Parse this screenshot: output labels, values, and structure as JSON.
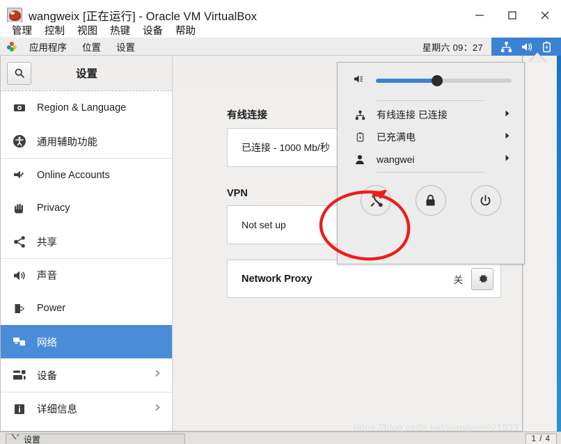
{
  "vbox": {
    "title": "wangweix [正在运行] - Oracle VM VirtualBox",
    "icon": "virtualbox-icon",
    "window_buttons": [
      {
        "name": "minimize-button",
        "glyph": "minimize-icon"
      },
      {
        "name": "maximize-button",
        "glyph": "maximize-icon"
      },
      {
        "name": "close-button",
        "glyph": "close-icon"
      }
    ],
    "menu": [
      {
        "label": "管理"
      },
      {
        "label": "控制"
      },
      {
        "label": "视图"
      },
      {
        "label": "热键"
      },
      {
        "label": "设备"
      },
      {
        "label": "帮助"
      }
    ]
  },
  "gnome_panel": {
    "app_icon": "applications-icon",
    "menus": [
      {
        "label": "应用程序"
      },
      {
        "label": "位置"
      },
      {
        "label": "设置"
      }
    ],
    "clock": "星期六 09：27",
    "status_icons": [
      {
        "name": "network-wired-icon"
      },
      {
        "name": "volume-icon"
      },
      {
        "name": "battery-charged-icon"
      }
    ],
    "status_bg": "#3b82d4"
  },
  "settings": {
    "header": {
      "search_icon": "search-icon",
      "title": "设置"
    },
    "sidebar": {
      "items": [
        {
          "label": "Region & Language",
          "icon": "region-language-icon",
          "selected": false,
          "chevron": false,
          "separator": false
        },
        {
          "label": "通用辅助功能",
          "icon": "accessibility-icon",
          "selected": false,
          "chevron": false,
          "separator": false
        },
        {
          "label": "Online Accounts",
          "icon": "online-accounts-icon",
          "selected": false,
          "chevron": false,
          "separator": true
        },
        {
          "label": "Privacy",
          "icon": "privacy-hand-icon",
          "selected": false,
          "chevron": false,
          "separator": false
        },
        {
          "label": "共享",
          "icon": "sharing-icon",
          "selected": false,
          "chevron": false,
          "separator": false
        },
        {
          "label": "声音",
          "icon": "sound-icon",
          "selected": false,
          "chevron": false,
          "separator": true
        },
        {
          "label": "Power",
          "icon": "power-plug-icon",
          "selected": false,
          "chevron": false,
          "separator": false
        },
        {
          "label": "网络",
          "icon": "network-icon",
          "selected": true,
          "chevron": false,
          "separator": false
        },
        {
          "label": "设备",
          "icon": "devices-icon",
          "selected": false,
          "chevron": true,
          "separator": false
        },
        {
          "label": "详细信息",
          "icon": "details-info-icon",
          "selected": false,
          "chevron": true,
          "separator": true
        }
      ]
    },
    "content": {
      "wired": {
        "title": "有线连接",
        "status": "已连接 - 1000 Mb/秒"
      },
      "vpn": {
        "title": "VPN",
        "status": "Not set up"
      },
      "proxy": {
        "label": "Network Proxy",
        "state": "关",
        "gear_icon": "gear-icon"
      }
    }
  },
  "system_menu": {
    "volume": {
      "icon": "volume-low-icon",
      "value": 45
    },
    "items": [
      {
        "label": "有线连接 已连接",
        "icon": "network-wired-icon",
        "arrow": "chevron-right-icon"
      },
      {
        "label": "已充满电",
        "icon": "battery-charged-icon",
        "arrow": "chevron-right-icon"
      },
      {
        "label": "wangwei",
        "icon": "user-icon",
        "arrow": "chevron-right-icon"
      }
    ],
    "actions": [
      {
        "name": "settings-tools-button",
        "icon": "tools-icon"
      },
      {
        "name": "lock-button",
        "icon": "lock-icon"
      },
      {
        "name": "power-button",
        "icon": "power-icon"
      }
    ]
  },
  "annotation": {
    "shape": "red-circle-highlight",
    "color": "#ee1c1c"
  },
  "bottom": {
    "task_item": {
      "label": "设置",
      "icon": "settings-tools-icon"
    },
    "page_indicator": "1 / 4",
    "watermark": "https://blog.csdn.net/wangwei021933"
  }
}
